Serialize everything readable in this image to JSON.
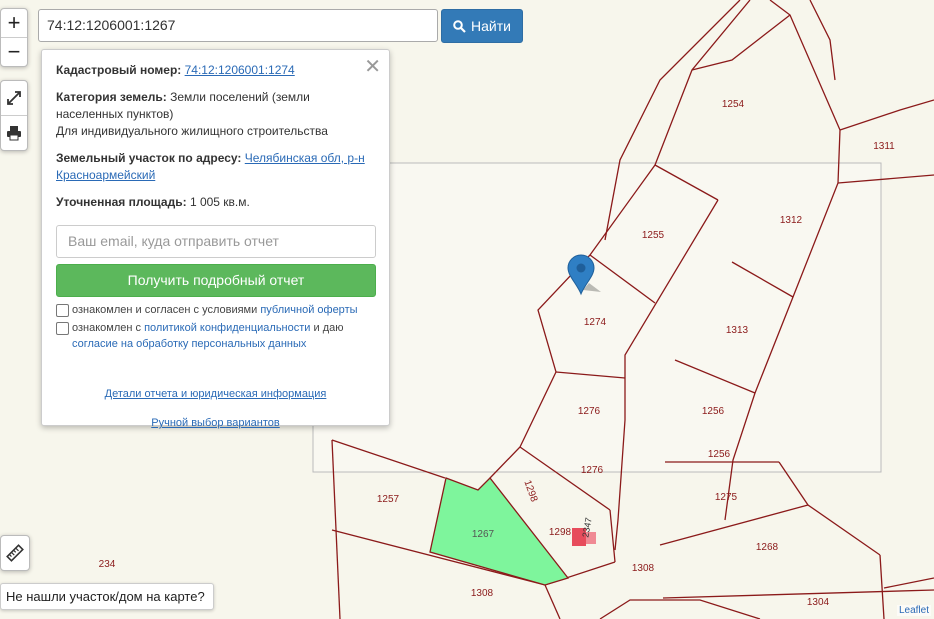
{
  "search": {
    "value": "74:12:1206001:1267",
    "button_label": "Найти",
    "button_icon": "search-icon"
  },
  "controls": {
    "zoom_in": "+",
    "zoom_out": "−",
    "icons": [
      "fullscreen-icon",
      "print-icon",
      "ruler-icon"
    ]
  },
  "popup": {
    "cadastral_label": "Кадастровый номер:",
    "cadastral_value": "74:12:1206001:1274",
    "category_label": "Категория земель:",
    "category_value": "Земли поселений (земли населенных пунктов)",
    "usage_value": "Для индивидуального жилищного строительства",
    "address_label": "Земельный участок по адресу:",
    "address_value": "Челябинская обл, р-н Красноармейский",
    "area_label": "Уточненная площадь:",
    "area_value": "1 005 кв.м.",
    "email_placeholder": "Ваш email, куда отправить отчет",
    "report_button": "Получить подробный отчет",
    "check1_text": "ознакомлен и согласен с условиями",
    "check1_link": "публичной оферты",
    "check2_text": "ознакомлен с",
    "check2_link": "политикой конфиденциальности",
    "check2_mid": "и даю",
    "check2_link2": "согласие на обработку персональных данных",
    "details_link": "Детали отчета и юридическая информация",
    "manual_link": "Ручной выбор вариантов"
  },
  "map_labels": [
    "1254",
    "1311",
    "1312",
    "1255",
    "1274",
    "1313",
    "1276",
    "1256",
    "1256",
    "1276",
    "1298",
    "1257",
    "1267",
    "1298",
    "2347",
    "1275",
    "1268",
    "1308",
    "1308",
    "1304",
    "234"
  ],
  "not_found": "Не нашли участок/дом на карте?",
  "attribution": "Leaflet",
  "colors": {
    "parcel_border": "#8b1a1a",
    "selected_parcel": "#7ef59c",
    "background": "#f7f6ec",
    "marker": "#2f7fc4"
  }
}
